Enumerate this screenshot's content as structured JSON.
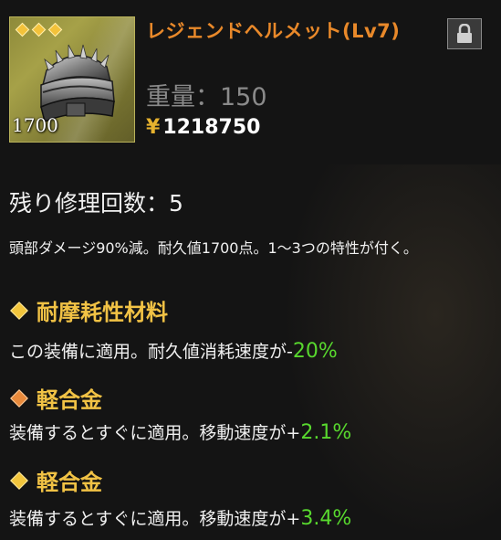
{
  "item": {
    "name": "レジェンドヘルメット(Lv7)",
    "rarity_stars": 3,
    "durability_display": "1700",
    "weight_label": "重量：",
    "weight_value": "150",
    "currency_icon": "yen-icon",
    "price": "1218750",
    "lock_icon": "lock-icon",
    "image_icon": "helmet-icon"
  },
  "repairs": {
    "label": "残り修理回数：",
    "value": "5"
  },
  "description": "頭部ダメージ90%減。耐久値1700点。1～3つの特性が付く。",
  "traits": [
    {
      "name": "耐摩耗性材料",
      "diamond_color": "#f2c53c",
      "desc_prefix": "この装備に適用。耐久値消耗速度が-",
      "value": "20%"
    },
    {
      "name": "軽合金",
      "diamond_color": "#e88a3c",
      "desc_prefix": "装備するとすぐに適用。移動速度が+",
      "value": "2.1%"
    },
    {
      "name": "軽合金",
      "diamond_color": "#f2c53c",
      "desc_prefix": "装備するとすぐに適用。移動速度が+",
      "value": "3.4%"
    }
  ],
  "colors": {
    "title": "#e9892a",
    "trait_title": "#f1c245",
    "value_green": "#58d82e",
    "rarity": "#f3c23a"
  }
}
